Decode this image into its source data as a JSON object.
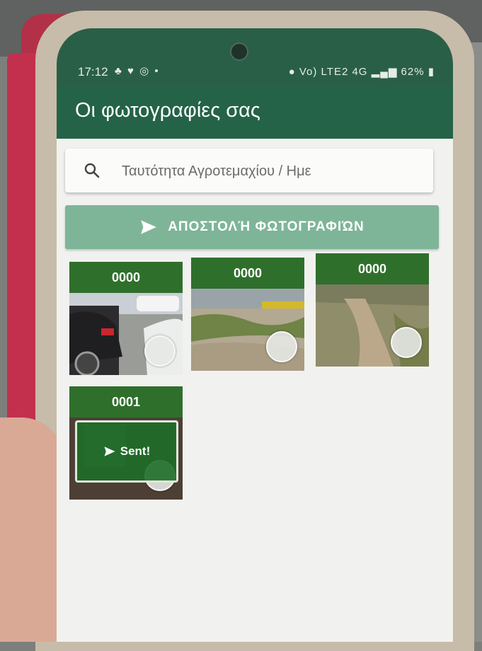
{
  "status_bar": {
    "time": "17:12",
    "left_icons": "♣ ♥ ◎ •",
    "network": "Vo) LTE2 4G",
    "battery": "62%"
  },
  "app_bar": {
    "title": "Οι φωτογραφίες σας"
  },
  "search": {
    "placeholder": "Ταυτότητα Αγροτεμαχίου / Ημε"
  },
  "send_button": {
    "label": "ΑΠΟΣΤΟΛΉ ΦΩΤΟΓΡΑΦΙΏΝ"
  },
  "photos": [
    {
      "id": "0000",
      "scene": "parked-cars",
      "sent": false
    },
    {
      "id": "0000",
      "scene": "grass-and-curb",
      "sent": false
    },
    {
      "id": "0000",
      "scene": "dirt-path",
      "sent": false
    },
    {
      "id": "0001",
      "scene": "dark",
      "sent": true,
      "sent_label": "Sent!"
    }
  ],
  "colors": {
    "status_bar": "#2a5f47",
    "app_bar": "#246348",
    "send_button": "#7eb598",
    "card_header": "#2f6f2c",
    "background": "#f1f2ef"
  }
}
